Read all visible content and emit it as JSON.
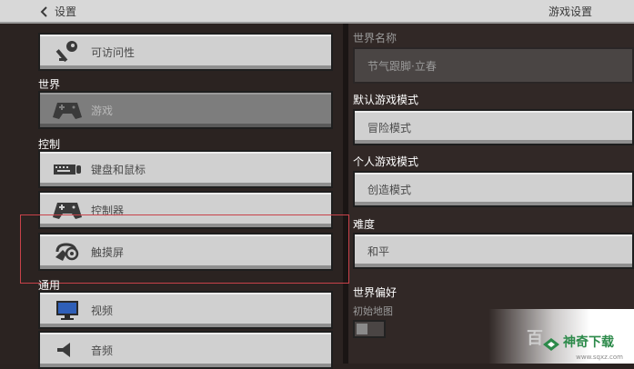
{
  "topbar": {
    "back_label": "设置",
    "right_title": "游戏设置"
  },
  "left": {
    "items": [
      {
        "label": "可访问性",
        "icon": "key-icon"
      },
      {
        "label": "游戏",
        "icon": "gamepad-icon"
      },
      {
        "label": "键盘和鼠标",
        "icon": "keyboard-icon"
      },
      {
        "label": "控制器",
        "icon": "controller-icon"
      },
      {
        "label": "触摸屏",
        "icon": "touch-icon"
      },
      {
        "label": "视频",
        "icon": "monitor-icon"
      },
      {
        "label": "音频",
        "icon": "speaker-icon"
      }
    ],
    "sections": {
      "world": "世界",
      "controls": "控制",
      "general": "通用"
    }
  },
  "right": {
    "world_name_label": "世界名称",
    "world_name_value": "节气跟脚·立春",
    "default_mode_label": "默认游戏模式",
    "default_mode_value": "冒险模式",
    "personal_mode_label": "个人游戏模式",
    "personal_mode_value": "创造模式",
    "difficulty_label": "难度",
    "difficulty_value": "和平",
    "world_pref_label": "世界偏好",
    "starting_map_label": "初始地图"
  },
  "watermark": {
    "brand": "神奇下载",
    "site": "www.sqxz.com",
    "baidu": "百"
  },
  "colors": {
    "highlight": "#c8424a",
    "button": "#d0d0d0",
    "active_button": "#7d7d7d"
  }
}
